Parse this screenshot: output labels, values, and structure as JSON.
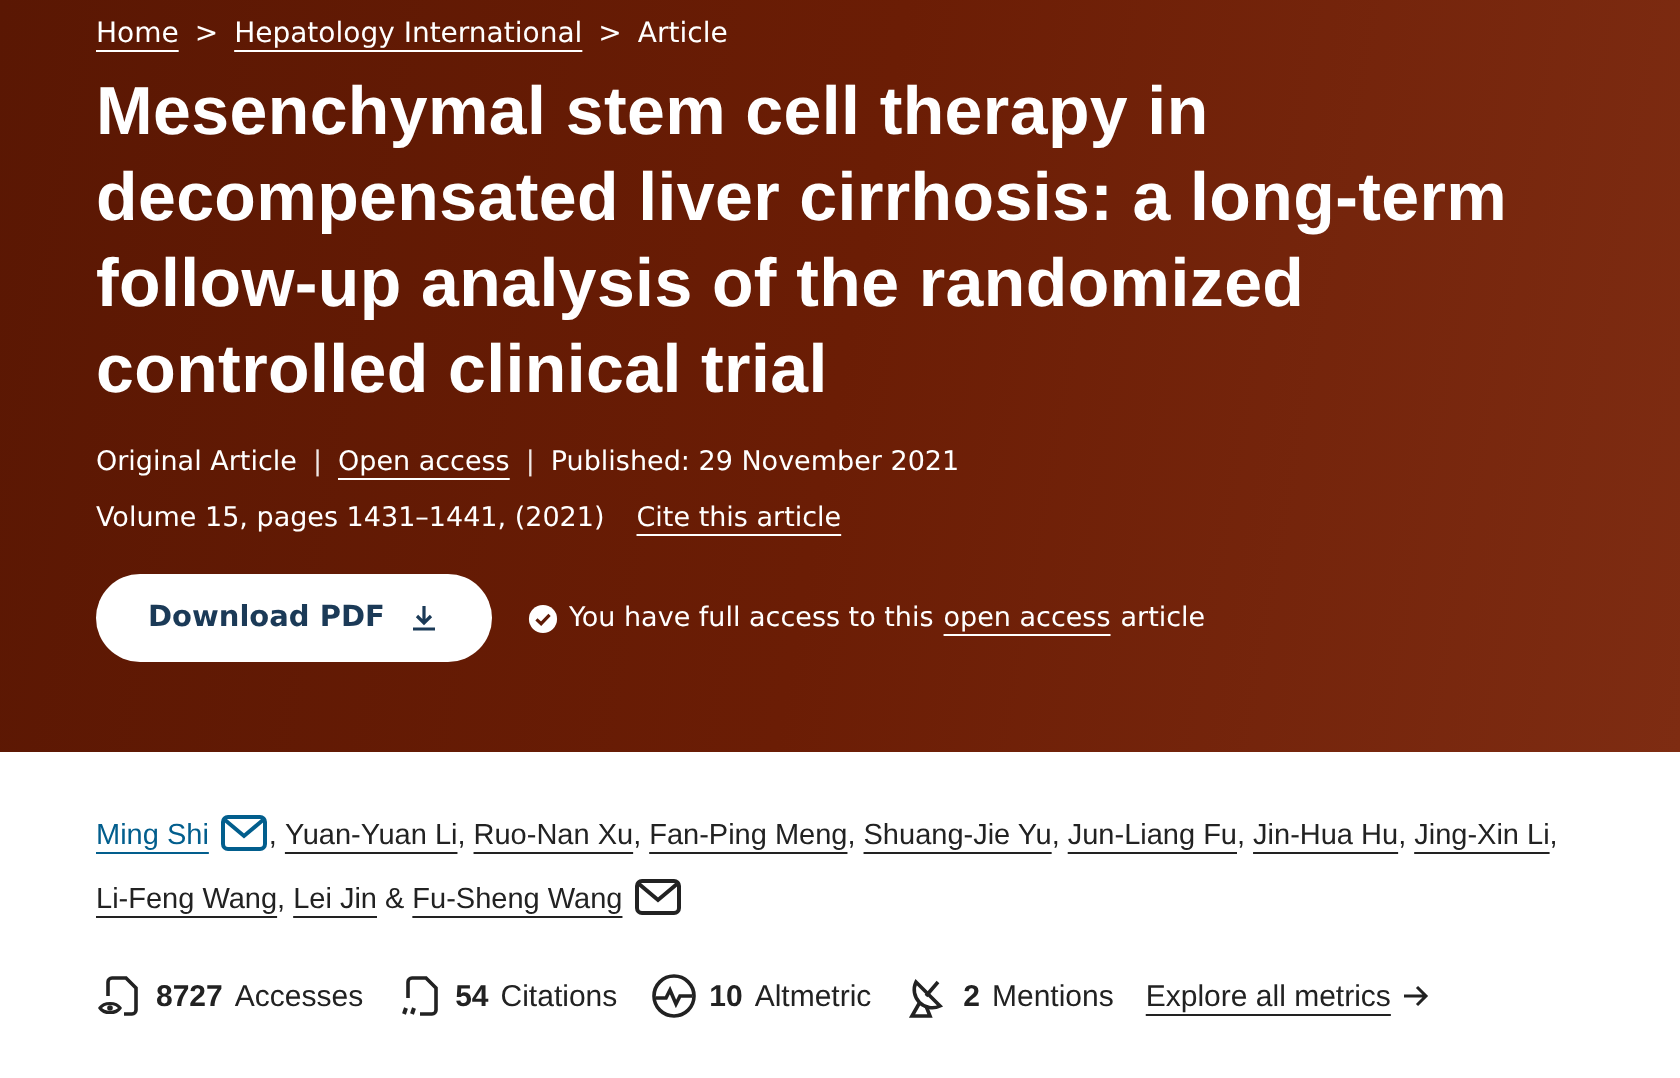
{
  "breadcrumbs": [
    {
      "label": "Home",
      "link": true
    },
    {
      "label": "Hepatology International",
      "link": true
    },
    {
      "label": "Article",
      "link": false
    }
  ],
  "breadcrumb_separator": ">",
  "title": "Mesenchymal stem cell therapy in decompensated liver cirrhosis: a long-term follow-up analysis of the randomized controlled clinical trial",
  "meta": [
    {
      "label": "Original Article",
      "link": false
    },
    {
      "label": "Open access",
      "link": true
    },
    {
      "label": "Published: 29 November 2021",
      "link": false
    }
  ],
  "meta_separator": "|",
  "volume": "Volume 15, pages 1431–1441, (2021)",
  "cite_link": "Cite this article",
  "download_button": "Download PDF",
  "access_note": {
    "before": "You have full access to this",
    "link": "open access",
    "after": "article"
  },
  "authors": [
    {
      "name": "Ming Shi",
      "email": true,
      "active": true,
      "separator": ","
    },
    {
      "name": "Yuan-Yuan Li",
      "email": false,
      "active": false,
      "separator": ","
    },
    {
      "name": "Ruo-Nan Xu",
      "email": false,
      "active": false,
      "separator": ","
    },
    {
      "name": "Fan-Ping Meng",
      "email": false,
      "active": false,
      "separator": ","
    },
    {
      "name": "Shuang-Jie Yu",
      "email": false,
      "active": false,
      "separator": ","
    },
    {
      "name": "Jun-Liang Fu",
      "email": false,
      "active": false,
      "separator": ","
    },
    {
      "name": "Jin-Hua Hu",
      "email": false,
      "active": false,
      "separator": ","
    },
    {
      "name": "Jing-Xin Li",
      "email": false,
      "active": false,
      "separator": ","
    },
    {
      "name": "Li-Feng Wang",
      "email": false,
      "active": false,
      "separator": ","
    },
    {
      "name": "Lei Jin",
      "email": false,
      "active": false,
      "separator": "&"
    },
    {
      "name": "Fu-Sheng Wang",
      "email": true,
      "active": false
    }
  ],
  "metrics": [
    {
      "kind": "accesses",
      "count": "8727",
      "label": "Accesses"
    },
    {
      "kind": "citations",
      "count": "54",
      "label": "Citations"
    },
    {
      "kind": "altmetric",
      "count": "10",
      "label": "Altmetric"
    },
    {
      "kind": "mentions",
      "count": "2",
      "label": "Mentions"
    }
  ],
  "metrics_link": "Explore all metrics"
}
